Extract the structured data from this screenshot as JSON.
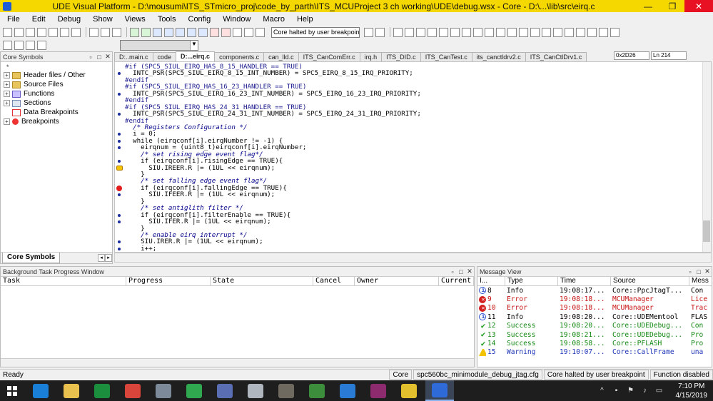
{
  "window": {
    "title": "UDE Visual Platform - D:\\mousumi\\ITS_STmicro_proj\\code_by_parth\\ITS_MCUProject 3 ch working\\UDE\\debug.wsx - Core - D:\\...\\lib\\src\\eirq.c",
    "minimize": "—",
    "maximize": "❐",
    "close": "✕"
  },
  "menu": [
    "File",
    "Edit",
    "Debug",
    "Show",
    "Views",
    "Tools",
    "Config",
    "Window",
    "Macro",
    "Help"
  ],
  "toolbar": {
    "core_status": "Core halted by user breakpoint"
  },
  "left_panel": {
    "title": "Core Symbols",
    "root": "*",
    "items": [
      {
        "label": "Header files / Other",
        "icon": "folder-icon"
      },
      {
        "label": "Source Files",
        "icon": "folder-icon"
      },
      {
        "label": "Functions",
        "icon": "functions-icon"
      },
      {
        "label": "Sections",
        "icon": "sections-icon"
      },
      {
        "label": "Data Breakpoints",
        "icon": "data-breakpoint-icon"
      },
      {
        "label": "Breakpoints",
        "icon": "breakpoint-icon"
      }
    ],
    "tab": "Core Symbols"
  },
  "editor": {
    "tabs": [
      "D:..main.c",
      "code",
      "D:...eirq.c",
      "components.c",
      "can_lld.c",
      "ITS_CanComErr.c",
      "irq.h",
      "ITS_DID.c",
      "ITS_CanTest.c",
      "its_canctldrv2.c",
      "ITS_CanCtlDrv1.c"
    ],
    "active_tab": 2,
    "address": "0x2D26",
    "line": "Ln 214",
    "lines": [
      {
        "text": "#if (SPC5_SIUL_EIRQ_HAS_8_15_HANDLER == TRUE)",
        "kind": "pp",
        "marker": ""
      },
      {
        "text": "  INTC_PSR(SPC5_SIUL_EIRQ_8_15_INT_NUMBER) = SPC5_EIRQ_8_15_IRQ_PRIORITY;",
        "kind": "",
        "marker": "dot"
      },
      {
        "text": "#endif",
        "kind": "pp",
        "marker": ""
      },
      {
        "text": "#if (SPC5_SIUL_EIRQ_HAS_16_23_HANDLER == TRUE)",
        "kind": "pp",
        "marker": ""
      },
      {
        "text": "  INTC_PSR(SPC5_SIUL_EIRQ_16_23_INT_NUMBER) = SPC5_EIRQ_16_23_IRQ_PRIORITY;",
        "kind": "",
        "marker": "dot"
      },
      {
        "text": "#endif",
        "kind": "pp",
        "marker": ""
      },
      {
        "text": "#if (SPC5_SIUL_EIRQ_HAS_24_31_HANDLER == TRUE)",
        "kind": "pp",
        "marker": ""
      },
      {
        "text": "  INTC_PSR(SPC5_SIUL_EIRQ_24_31_INT_NUMBER) = SPC5_EIRQ_24_31_IRQ_PRIORITY;",
        "kind": "",
        "marker": "dot"
      },
      {
        "text": "#endif",
        "kind": "pp",
        "marker": ""
      },
      {
        "text": "  /* Registers Configuration */",
        "kind": "cm",
        "marker": ""
      },
      {
        "text": "  i = 0;",
        "kind": "",
        "marker": "dot"
      },
      {
        "text": "  while (eirqconf[i].eirqNumber != -1) {",
        "kind": "",
        "marker": "dot"
      },
      {
        "text": "    eirqnum = (uint8_t)eirqconf[i].eirqNumber;",
        "kind": "",
        "marker": "dot"
      },
      {
        "text": "    /* set rising edge event flag*/",
        "kind": "cm",
        "marker": ""
      },
      {
        "text": "    if (eirqconf[i].risingEdge == TRUE){",
        "kind": "",
        "marker": "dot"
      },
      {
        "text": "      SIU.IREER.R |= (1UL << eirqnum);",
        "kind": "",
        "marker": "arrow"
      },
      {
        "text": "    }",
        "kind": "",
        "marker": ""
      },
      {
        "text": "    /* set falling edge event flag*/",
        "kind": "cm",
        "marker": ""
      },
      {
        "text": "    if (eirqconf[i].fallingEdge == TRUE){",
        "kind": "",
        "marker": "bp"
      },
      {
        "text": "      SIU.IFEER.R |= (1UL << eirqnum);",
        "kind": "",
        "marker": "dot"
      },
      {
        "text": "    }",
        "kind": "",
        "marker": ""
      },
      {
        "text": "    /* set antiglith filter */",
        "kind": "cm",
        "marker": ""
      },
      {
        "text": "    if (eirqconf[i].filterEnable == TRUE){",
        "kind": "",
        "marker": "dot"
      },
      {
        "text": "      SIU.IFER.R |= (1UL << eirqnum);",
        "kind": "",
        "marker": "dot"
      },
      {
        "text": "    }",
        "kind": "",
        "marker": ""
      },
      {
        "text": "    /* enable eirq interrupt */",
        "kind": "cm",
        "marker": ""
      },
      {
        "text": "    SIU.IRER.R |= (1UL << eirqnum);",
        "kind": "",
        "marker": "dot"
      },
      {
        "text": "    i++;",
        "kind": "",
        "marker": "dot"
      },
      {
        "text": "  }",
        "kind": "",
        "marker": ""
      }
    ]
  },
  "task_window": {
    "title": "Background Task Progress Window",
    "columns": [
      "Task",
      "Progress",
      "State",
      "Cancel",
      "Owner",
      "Current"
    ]
  },
  "message_view": {
    "title": "Message View",
    "columns": [
      "I...",
      "Type",
      "Time",
      "Source",
      "Mess"
    ],
    "rows": [
      {
        "id": "8",
        "type": "Info",
        "time": "19:08:17...",
        "source": "Core::PpcJtagT...",
        "msg": "Con",
        "level": "info"
      },
      {
        "id": "9",
        "type": "Error",
        "time": "19:08:18...",
        "source": "MCUManager",
        "msg": "Lice",
        "level": "err"
      },
      {
        "id": "10",
        "type": "Error",
        "time": "19:08:18...",
        "source": "MCUManager",
        "msg": "Trac",
        "level": "err"
      },
      {
        "id": "11",
        "type": "Info",
        "time": "19:08:20...",
        "source": "Core::UDEMemtool",
        "msg": "FLAS",
        "level": "info"
      },
      {
        "id": "12",
        "type": "Success",
        "time": "19:08:20...",
        "source": "Core::UDEDebug...",
        "msg": "Con",
        "level": "ok"
      },
      {
        "id": "13",
        "type": "Success",
        "time": "19:08:21...",
        "source": "Core::UDEDebug...",
        "msg": "Pro",
        "level": "ok"
      },
      {
        "id": "14",
        "type": "Success",
        "time": "19:08:58...",
        "source": "Core::PFLASH",
        "msg": "Pro",
        "level": "ok"
      },
      {
        "id": "15",
        "type": "Warning",
        "time": "19:10:07...",
        "source": "Core::CallFrame",
        "msg": "una",
        "level": "warn"
      }
    ]
  },
  "statusbar": {
    "ready": "Ready",
    "core": "Core",
    "config": "spc560bc_minimodule_debug_jtag.cfg",
    "status": "Core halted by user breakpoint",
    "function": "Function disabled"
  },
  "taskbar": {
    "time": "7:10 PM",
    "date": "4/15/2019",
    "apps": [
      "internet-explorer",
      "file-explorer",
      "store",
      "chrome",
      "app-5",
      "app-6",
      "calculator",
      "app-8",
      "app-9",
      "app-10",
      "app-11",
      "winrar",
      "help",
      "ude"
    ],
    "colors": {
      "internet-explorer": "#1a7fd6",
      "file-explorer": "#e8c14e",
      "store": "#1b8f3d",
      "chrome": "#d9453b",
      "app-5": "#7c8a9a",
      "app-6": "#2fa84f",
      "calculator": "#5a6fb3",
      "app-8": "#b0b6be",
      "app-9": "#6f6a60",
      "app-10": "#3c8d3c",
      "app-11": "#2a7bd4",
      "winrar": "#8d2b6e",
      "help": "#e3c02e",
      "ude": "#2f6bd8"
    }
  }
}
